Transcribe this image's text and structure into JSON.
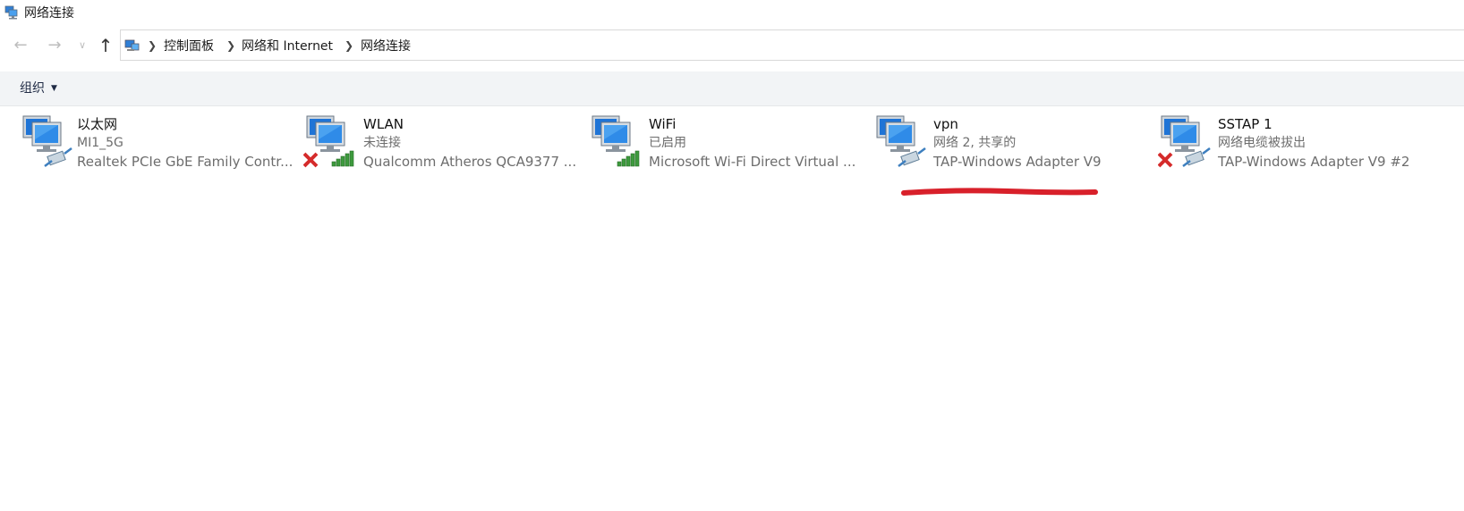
{
  "window": {
    "title": "网络连接",
    "title_icon": "network-connections-icon"
  },
  "nav": {
    "back_icon": "back-arrow-icon",
    "forward_icon": "forward-arrow-icon",
    "recent_icon": "chevron-down-icon",
    "up_icon": "up-arrow-icon"
  },
  "address": {
    "icon": "control-panel-icon",
    "breadcrumbs": [
      "控制面板",
      "网络和 Internet",
      "网络连接"
    ]
  },
  "command_bar": {
    "organize_label": "组织"
  },
  "connections": [
    {
      "name": "以太网",
      "status": "MI1_5G",
      "device": "Realtek PCIe GbE Family Contr...",
      "type": "ethernet",
      "disconnected": false
    },
    {
      "name": "WLAN",
      "status": "未连接",
      "device": "Qualcomm Atheros QCA9377 ...",
      "type": "wireless",
      "disconnected": true
    },
    {
      "name": "WiFi",
      "status": "已启用",
      "device": "Microsoft Wi-Fi Direct Virtual ...",
      "type": "wireless",
      "disconnected": false
    },
    {
      "name": "vpn",
      "status": "网络 2, 共享的",
      "device": "TAP-Windows Adapter V9",
      "type": "ethernet",
      "disconnected": false
    },
    {
      "name": "SSTAP 1",
      "status": "网络电缆被拔出",
      "device": "TAP-Windows Adapter V9 #2",
      "type": "ethernet",
      "disconnected": true
    }
  ],
  "colors": {
    "annotation_red": "#d8202a",
    "command_bar_bg": "#f2f4f6",
    "signal_green": "#3d9a3d"
  }
}
